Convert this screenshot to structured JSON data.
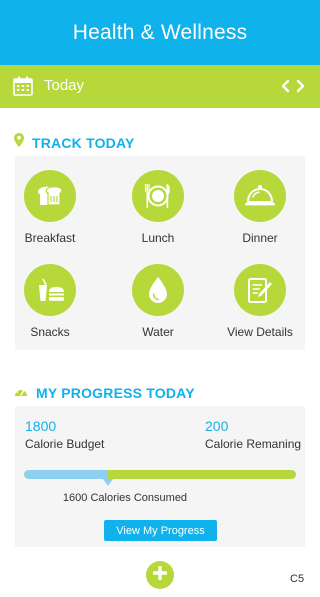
{
  "header": {
    "title": "Health & Wellness"
  },
  "datebar": {
    "date_label": "Today",
    "icons": [
      "calendar-icon",
      "chevron-left-icon",
      "chevron-right-icon"
    ]
  },
  "track": {
    "title": "TRACK TODAY",
    "icon": "map-pin-icon",
    "items": [
      {
        "label": "Breakfast",
        "icon": "bread-icon"
      },
      {
        "label": "Lunch",
        "icon": "plate-cutlery-icon"
      },
      {
        "label": "Dinner",
        "icon": "cloche-icon"
      },
      {
        "label": "Snacks",
        "icon": "snack-icon"
      },
      {
        "label": "Water",
        "icon": "water-drop-icon"
      },
      {
        "label": "View Details",
        "icon": "notepad-icon"
      }
    ]
  },
  "progress": {
    "title": "MY PROGRESS TODAY",
    "icon": "gauge-icon",
    "budget_value": "1800",
    "budget_label": "Calorie Budget",
    "remaining_value": "200",
    "remaining_label": "Calorie Remaning",
    "consumed_label": "1600 Calories Consumed",
    "consumed_fraction": 0.31,
    "button_label": "View My Progress"
  },
  "footer": {
    "add_icon": "plus-icon",
    "corner_code": "C5"
  },
  "colors": {
    "blue": "#0fb2ea",
    "green": "#b7d83a",
    "light_blue": "#8ecff2",
    "card": "#f5f5f5"
  }
}
